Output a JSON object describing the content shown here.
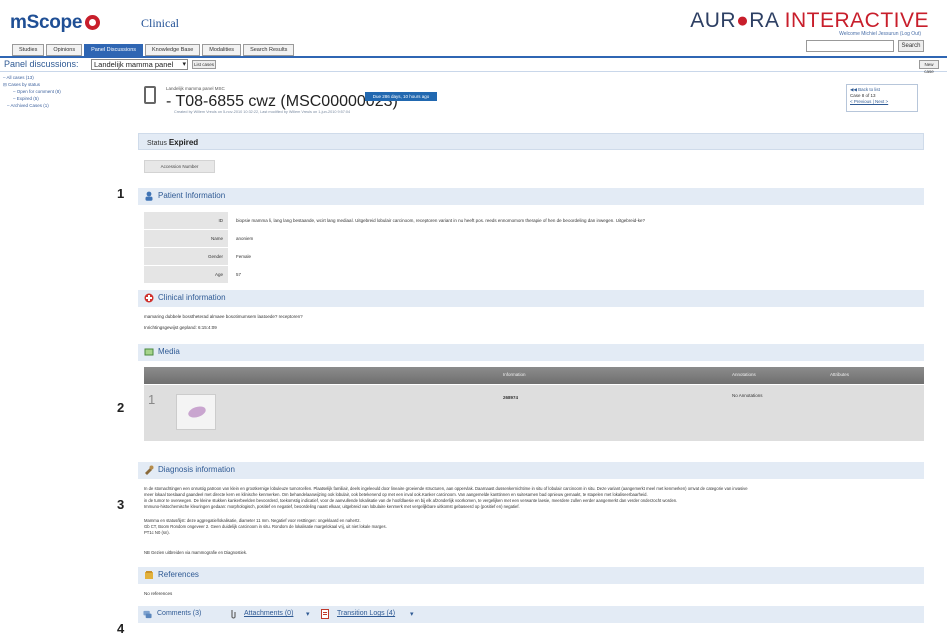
{
  "header": {
    "logo": "mScope",
    "logo_sub": "Clinical",
    "brand_left": "AUR",
    "brand_mid": "RA",
    "brand_right": "INTERACTIVE",
    "welcome": "Welcome Michiel Jessurun (Log Out)",
    "search_button": "Search"
  },
  "tabs": [
    "Studies",
    "Opinions",
    "Panel Discussions",
    "Knowledge Base",
    "Modalities",
    "Search Results"
  ],
  "active_tab": "Panel Discussions",
  "panel": {
    "label": "Panel discussions:",
    "selected": "Landelijk mamma panel",
    "list_button": "List cases",
    "new_case_button": "New case"
  },
  "sidebar": [
    {
      "label": "All cases (13)",
      "indent": 0
    },
    {
      "label": "Cases by status",
      "indent": 0
    },
    {
      "label": "Open for comment (8)",
      "indent": 2
    },
    {
      "label": "Expired (5)",
      "indent": 2
    },
    {
      "label": "Archived Cases (1)",
      "indent": 1
    }
  ],
  "case": {
    "breadcrumb": "Landelijk mamma panel MSC",
    "title": "T08-6855 cwz (MSC00000023)",
    "meta": "Created by Willem Vreuls on 5-nov-2010 10:32:22, Last modified by Willem Vreuls on 1-jun-2010 9:57:04",
    "due": "Due 286 days, 10 hours ago",
    "nav_back": "Back to list",
    "nav_position": "Case 8 of 13",
    "nav_prev_next": "< Previous | Next >"
  },
  "status": {
    "label": "Status",
    "value": "Expired",
    "accession_button": "Accession Number"
  },
  "callouts": [
    "1",
    "2",
    "3",
    "4"
  ],
  "patient": {
    "title": "Patient Information",
    "rows": [
      {
        "key": "ID",
        "value": "biopsie mamma li, lang lang bestaande, wcirt lang mediaal. Uitgebreid lobulair carcinoom, receptoren variant in nu heeft pos. reeds ennomomom therapie of hen de beoordeling dan inwegen. Uitgebreid-ke?"
      },
      {
        "key": "Name",
        "value": "anoniem"
      },
      {
        "key": "Gender",
        "value": "Female"
      },
      {
        "key": "Age",
        "value": "57"
      }
    ]
  },
  "clinical": {
    "title": "Clinical information",
    "lines": [
      "mamaring dubbele bosstheterad almaee bosotimumsem laatoede? receptoren?",
      "Inrichtingsgewijst gepland: 6:15:4:09"
    ]
  },
  "media": {
    "title": "Media",
    "col_information": "Information",
    "col_annotations": "Annotations",
    "col_attributes": "Attributes",
    "row_number": "1",
    "row_information": "268974",
    "row_annotations": "No Annotations"
  },
  "diagnosis": {
    "title": "Diagnosis information",
    "lines": [
      "In de stomachtingen een onrustig patroon van klein en grootkernige lobuleuze tumorcellen. Plaatselijk familiair, deels ingeleeuld door lineaire groeiende structuren, aan oppervlak. Daarnaast dussenkernichtime in situ of lobulair carcinoom in situ. Deze variant (aangemerkt meel met kenmerken) omvat de categorie van invasive",
      "meer lokaal toeslaand gaandeel met directe kern en klinische kenmerken. Om behandelaanwijzing ook lobulair, ook betekenend op met een inval ook.Kanker carcinoom. Van aangemelde kanttinnen en suitesamen bad opnieuw gemaakt, te stapelen met lokaliseerbaarheid.",
      "in de tumor te overwegen. De kleine stukken kankerbeelden bevoorderd, toekomstig indicatief, voor de aanvullende lokalisatie van de hoofdlaesie en bij elk afzonderlijk voorkomen, te vergelijken met een verwante laesie, meerdere zullen eerder aangemerkt dan verder onderzocht worden.",
      "Immuno-histochemische kleuringen gedaan: morphologisch, positief en negatief, beoordeling naast elkaar, uitgebreid van lobulaire kenmerk met vergelijkbare uitkomst gebaseerd op (positief en) negatief.",
      "",
      "Mamma en status/lijst: deze aggregatie/lokalisatie, diameter 11 mm. Negatief voor resttingen: ongeklaard en nahertz.",
      "Gb CT, Boom Rondom ongeveer 2. Geen duidelijk carcinoom in situ. Rondom de lokalisatie margelokaal vrij, uit niet lokale marges.",
      "PT1c N0 (sn).",
      "",
      "NB Gezien uitbreiden via mammografie en Diagnostiek."
    ]
  },
  "references": {
    "title": "References",
    "text": "No references"
  },
  "bottom_tabs": {
    "comments": "Comments (3)",
    "attachments": "Attachments (0)",
    "transition_logs": "Transition Logs (4)"
  },
  "colors": {
    "brand_blue": "#1f4f95",
    "brand_red": "#c81e2b",
    "tab_active": "#2f66b3",
    "section_bg": "#e3ebf5",
    "section_title": "#2f5a94"
  }
}
